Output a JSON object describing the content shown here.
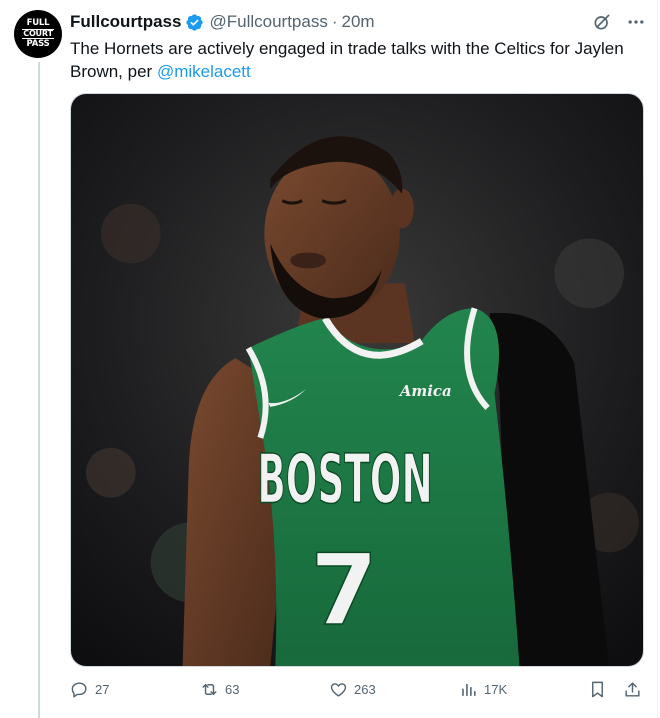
{
  "tweet": {
    "avatar_lines": [
      "FULL",
      "COURT",
      "PASS"
    ],
    "author_name": "Fullcourtpass",
    "handle": "@Fullcourtpass",
    "separator": "·",
    "time": "20m",
    "text_before": "The Hornets are actively engaged in trade talks with the Celtics for Jaylen Brown, per ",
    "mention": "@mikelacett",
    "jersey_city": "BOSTON",
    "jersey_number": "7",
    "jersey_sponsor": "Amica"
  },
  "actions": {
    "replies": "27",
    "reposts": "63",
    "likes": "263",
    "views": "17K"
  },
  "icons": {
    "verified": "verified-badge-icon",
    "grok": "grok-icon",
    "more": "more-icon",
    "reply": "reply-icon",
    "repost": "repost-icon",
    "like": "heart-icon",
    "views": "views-icon",
    "bookmark": "bookmark-icon",
    "share": "share-icon"
  },
  "colors": {
    "accent": "#1d9bf0",
    "muted": "#536471",
    "jersey_green": "#1e7a46"
  }
}
